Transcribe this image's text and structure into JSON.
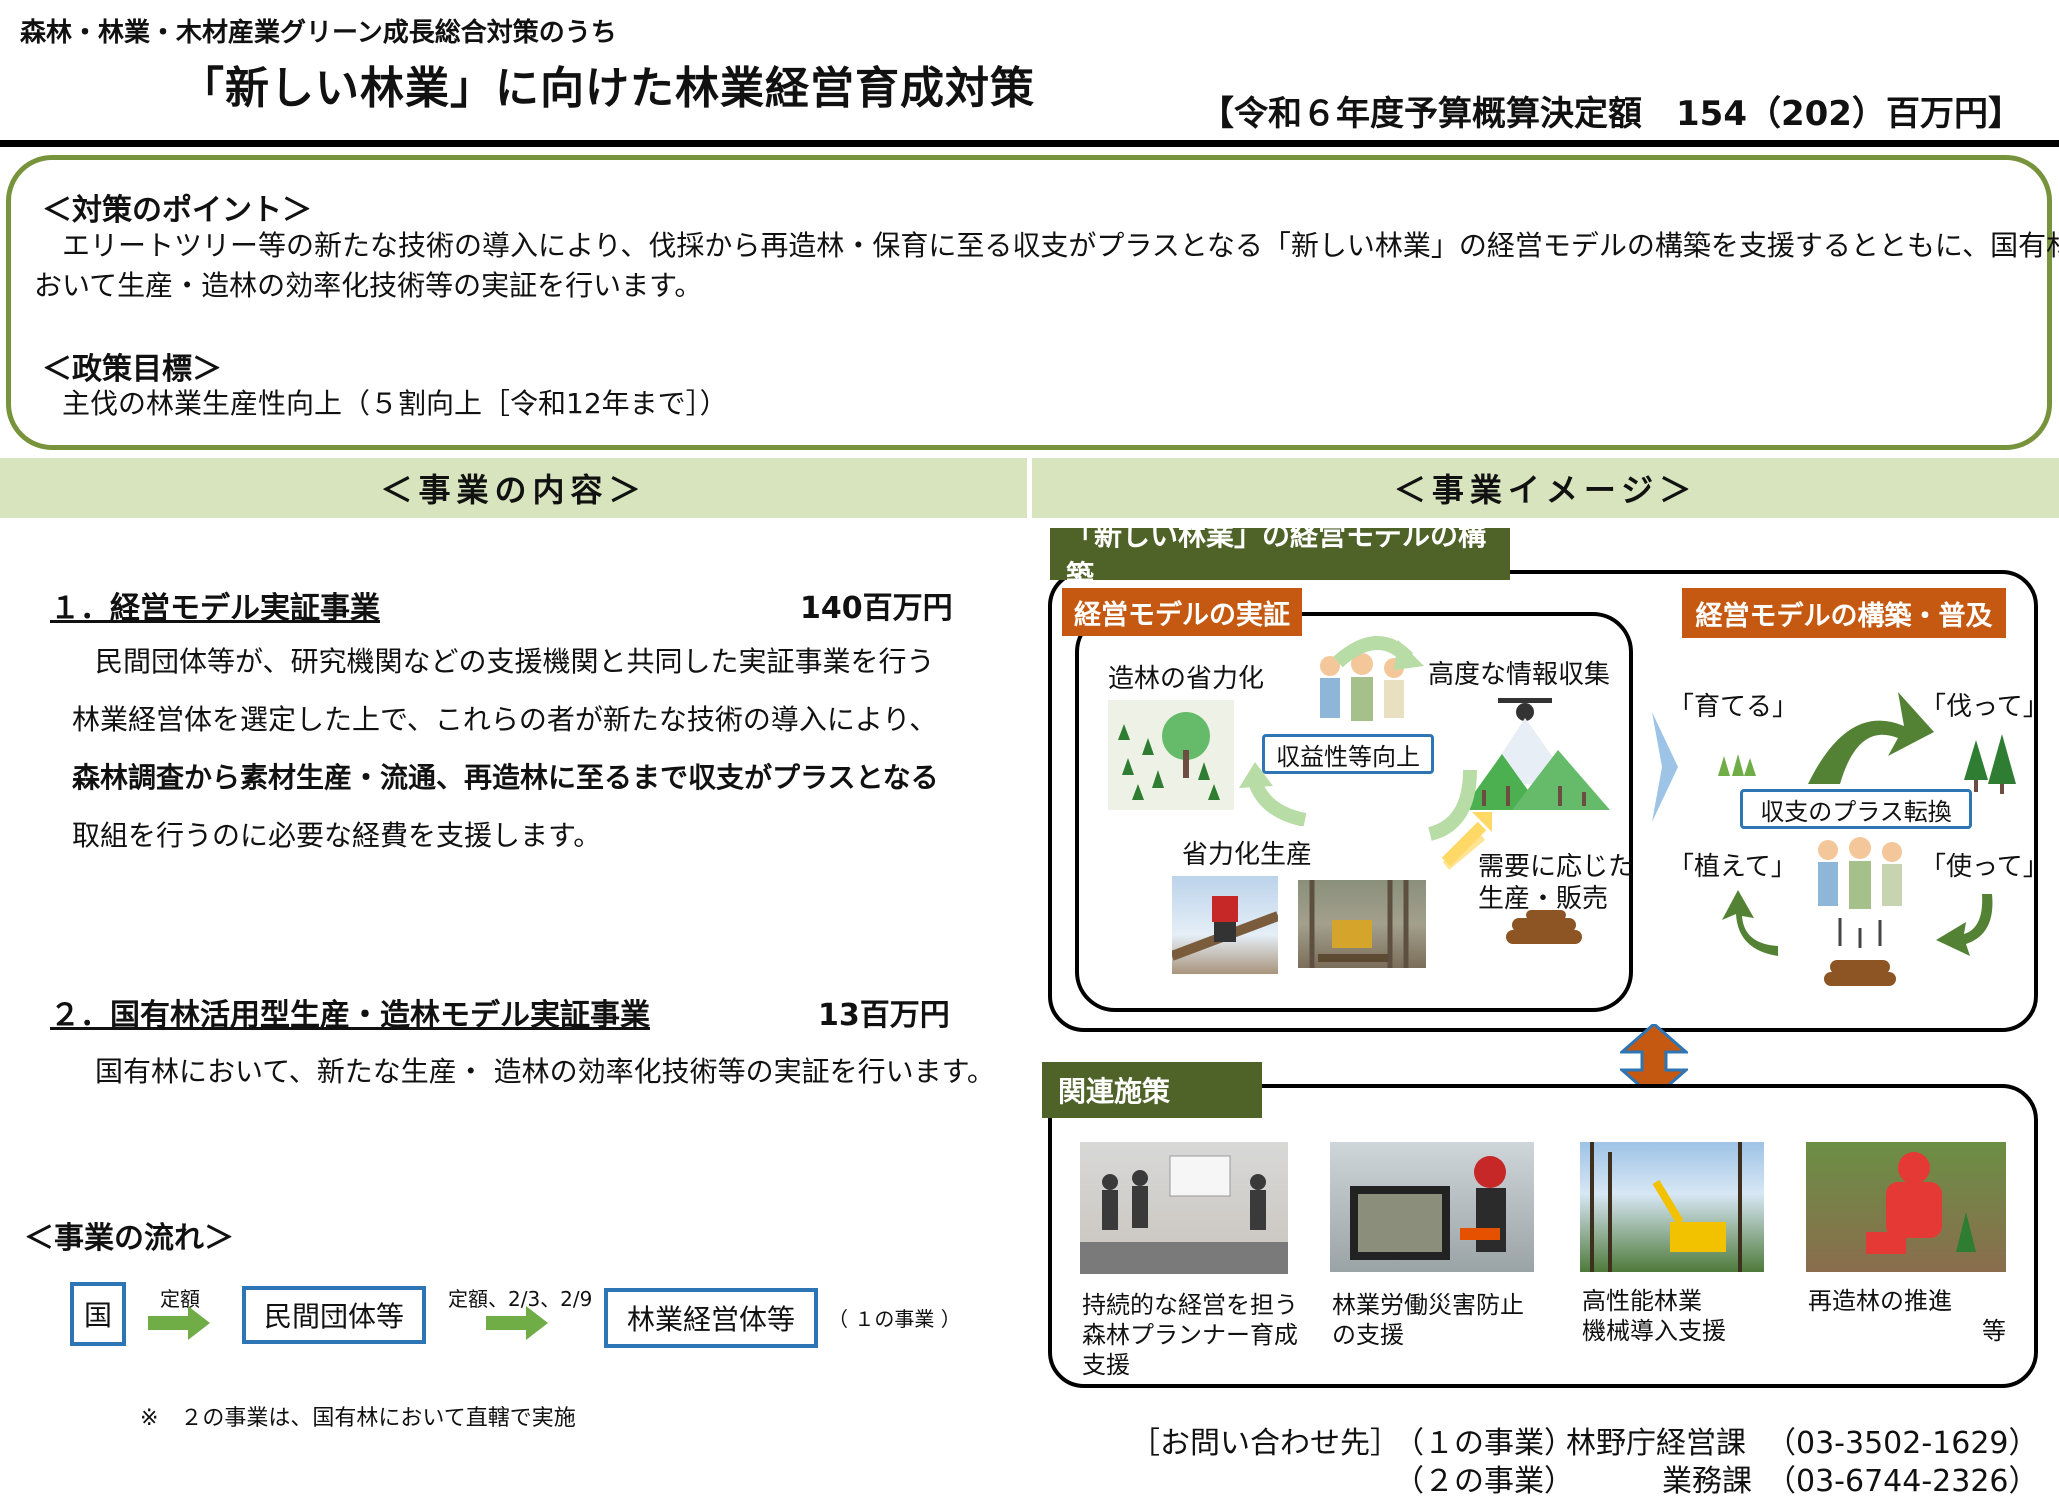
{
  "header": {
    "sup_title": "森林・林業・木材産業グリーン成長総合対策のうち",
    "main_title": "「新しい林業」に向けた林業経営育成対策",
    "budget": "【令和６年度予算概算決定額　154（202）百万円】"
  },
  "points": {
    "heading": "＜対策のポイント＞",
    "line1": "　エリートツリー等の新たな技術の導入により、伐採から再造林・保育に至る収支がプラスとなる「新しい林業」の経営モデルの構築を支援するとともに、国有林に",
    "line2": "おいて生産・造林の効率化技術等の実証を行います。",
    "goal_heading": "＜政策目標＞",
    "goal_text": "主伐の林業生産性向上（５割向上［令和12年まで］）"
  },
  "sections": {
    "left": "＜事業の内容＞",
    "right": "＜事業イメージ＞"
  },
  "content": {
    "item1_title": "１．経営モデル実証事業",
    "item1_amount": "140百万円",
    "item1_lines": [
      "民間団体等が、研究機関などの支援機関と共同した実証事業を行う",
      "林業経営体を選定した上で、これらの者が新たな技術の導入により、",
      "森林調査から素材生産・流通、再造林に至るまで収支がプラスとなる",
      "取組を行うのに必要な経費を支援します。"
    ],
    "item2_title": "２．国有林活用型生産・造林モデル実証事業",
    "item2_amount": "13百万円",
    "item2_line": "国有林において、新たな生産・ 造林の効率化技術等の実証を行います。"
  },
  "flow": {
    "heading": "＜事業の流れ＞",
    "box1": "国",
    "label1": "定額",
    "box2": "民間団体等",
    "label2": "定額、2/3、2/9",
    "box3": "林業経営体等",
    "note": "（ １の事業 ）",
    "footnote": "※　２の事業は、国有林において直轄で実施"
  },
  "image": {
    "model_tag": "「新しい林業」の経営モデルの構築",
    "verify_tag": "経営モデルの実証",
    "spread_tag": "経営モデルの構築・普及",
    "labels": {
      "planting_eff": "造林の省力化",
      "info": "高度な情報収集",
      "profit": "収益性等向上",
      "labor_prod": "省力化生産",
      "demand1": "需要に応じた",
      "demand2": "生産・販売",
      "grow": "「育てる」",
      "cut": "「伐って」",
      "plant": "「植えて」",
      "use": "「使って」",
      "plus": "収支のプラス転換"
    },
    "related_tag": "関連施策",
    "captions": [
      "持続的な経営を担う\n森林プランナー育成\n支援",
      "林業労働災害防止\nの支援",
      "高性能林業\n機械導入支援",
      "再造林の推進"
    ],
    "etc": "等"
  },
  "contact": {
    "label": "［お問い合わせ先］",
    "line1_proj": "（１の事業）",
    "line1_dept": "林野庁経営課",
    "line1_tel": "（03-3502-1629）",
    "line2_proj": "（２の事業）",
    "line2_dept": "業務課",
    "line2_tel": "（03-6744-2326）"
  },
  "colors": {
    "olive": "#77933c",
    "section_bg": "#d7e4bd",
    "dark_green": "#4f6228",
    "orange": "#c65911",
    "blue": "#2e75b6",
    "arrow_green": "#70ad47"
  }
}
